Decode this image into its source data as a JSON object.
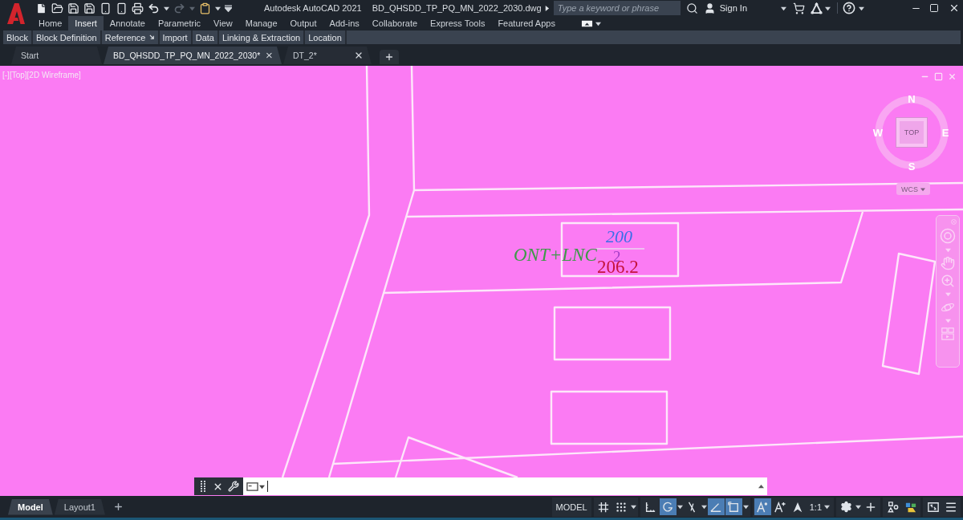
{
  "title_bar": {
    "app_title": "Autodesk AutoCAD 2021",
    "file_title": "BD_QHSDD_TP_PQ_MN_2022_2030.dwg",
    "search": {
      "placeholder": "Type a keyword or phrase"
    },
    "sign_in": "Sign In"
  },
  "quick_access": {
    "redo": {
      "disabled": true
    }
  },
  "ribbon_tabs": [
    {
      "label": "Home",
      "selected": false
    },
    {
      "label": "Insert",
      "selected": true
    },
    {
      "label": "Annotate",
      "selected": false
    },
    {
      "label": "Parametric",
      "selected": false
    },
    {
      "label": "View",
      "selected": false
    },
    {
      "label": "Manage",
      "selected": false
    },
    {
      "label": "Output",
      "selected": false
    },
    {
      "label": "Add-ins",
      "selected": false
    },
    {
      "label": "Collaborate",
      "selected": false
    },
    {
      "label": "Express Tools",
      "selected": false
    },
    {
      "label": "Featured Apps",
      "selected": false
    }
  ],
  "ribbon_panels": [
    {
      "label": "Block",
      "launcher": false
    },
    {
      "label": "Block Definition",
      "launcher": false
    },
    {
      "label": "Reference",
      "launcher": true
    },
    {
      "label": "Import",
      "launcher": false
    },
    {
      "label": "Data",
      "launcher": false
    },
    {
      "label": "Linking & Extraction",
      "launcher": false
    },
    {
      "label": "Location",
      "launcher": false
    }
  ],
  "file_tabs": [
    {
      "label": "Start",
      "selected": false,
      "closable": false
    },
    {
      "label": "BD_QHSDD_TP_PQ_MN_2022_2030*",
      "selected": true,
      "closable": true
    },
    {
      "label": "DT_2*",
      "selected": false,
      "closable": true
    }
  ],
  "viewport": {
    "controls": [
      "[-]",
      "[Top]",
      "[2D Wireframe]"
    ],
    "viewcube": {
      "face": "TOP",
      "north": "N",
      "east": "E",
      "south": "S",
      "west": "W",
      "coordinate_system": "WCS"
    },
    "annotations": [
      {
        "text": "200",
        "color": "#3a6ee8"
      },
      {
        "text": "ONT+LNC",
        "color": "#3e9a48"
      },
      {
        "text": "2",
        "color": "#a23cc6"
      },
      {
        "text": "206.2",
        "color": "#c4143c"
      }
    ]
  },
  "layout_tabs": [
    {
      "label": "Model",
      "selected": true
    },
    {
      "label": "Layout1",
      "selected": false
    }
  ],
  "status_bar": {
    "space": "MODEL",
    "groups": [
      {
        "items": [
          {
            "kind": "grid",
            "on": false,
            "menu": false
          },
          {
            "kind": "snap",
            "on": false,
            "menu": true
          }
        ]
      },
      {
        "items": [
          {
            "kind": "ortho",
            "on": false,
            "menu": false
          },
          {
            "kind": "polar",
            "on": true,
            "menu": true
          },
          {
            "kind": "isodraft",
            "on": false,
            "menu": true
          },
          {
            "kind": "tracking",
            "on": true,
            "menu": false
          },
          {
            "kind": "osnap",
            "on": true,
            "menu": true
          }
        ]
      },
      {
        "items": [
          {
            "kind": "annotation_visibility",
            "on": true,
            "menu": false
          },
          {
            "kind": "autoscale",
            "on": false,
            "menu": false
          },
          {
            "kind": "annotation_scale",
            "on": false,
            "menu": false
          },
          {
            "kind": "scale",
            "label": "1:1",
            "on": false,
            "menu": true
          }
        ]
      },
      {
        "items": [
          {
            "kind": "workspace",
            "on": false,
            "menu": true
          },
          {
            "kind": "units",
            "on": false,
            "menu": false
          }
        ]
      },
      {
        "items": [
          {
            "kind": "isolate",
            "on": false,
            "menu": false
          },
          {
            "kind": "hardware",
            "on": false,
            "menu": false
          }
        ]
      },
      {
        "items": [
          {
            "kind": "clean_screen",
            "on": false,
            "menu": false
          },
          {
            "kind": "customize",
            "on": false,
            "menu": false
          }
        ]
      }
    ]
  }
}
